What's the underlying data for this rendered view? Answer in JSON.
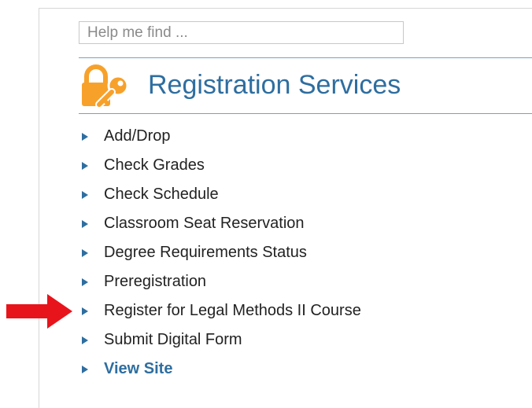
{
  "search": {
    "placeholder": "Help me find ..."
  },
  "header": {
    "title": "Registration Services",
    "icon": "lock-and-key-icon",
    "icon_color": "#f7a12b"
  },
  "menu": {
    "items": [
      {
        "label": "Add/Drop"
      },
      {
        "label": "Check Grades"
      },
      {
        "label": "Check Schedule"
      },
      {
        "label": "Classroom Seat Reservation"
      },
      {
        "label": "Degree Requirements Status"
      },
      {
        "label": "Preregistration"
      },
      {
        "label": "Register for Legal Methods II Course"
      },
      {
        "label": "Submit Digital Form"
      },
      {
        "label": "View Site"
      }
    ]
  },
  "colors": {
    "accent": "#2e6ea0",
    "rule": "#6fa3c8",
    "arrow": "#e8141b"
  }
}
